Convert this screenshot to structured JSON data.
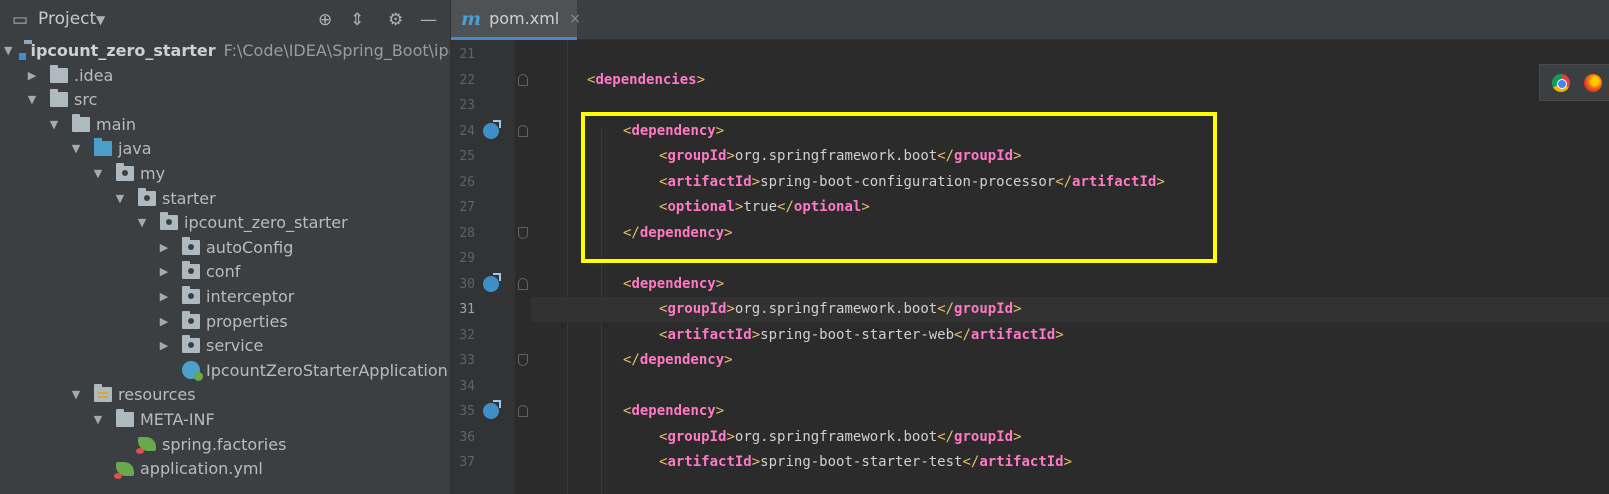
{
  "project_panel": {
    "title": "Project",
    "tree": [
      {
        "label": "ipcount_zero_starter",
        "path": "F:\\Code\\IDEA\\Spring_Boot\\ipcou",
        "icon": "module-icon",
        "expanded": true
      },
      {
        "label": ".idea",
        "icon": "folder-icon",
        "expanded": false
      },
      {
        "label": "src",
        "icon": "folder-icon",
        "expanded": true
      },
      {
        "label": "main",
        "icon": "folder-icon",
        "expanded": true
      },
      {
        "label": "java",
        "icon": "source-folder-icon",
        "expanded": true
      },
      {
        "label": "my",
        "icon": "package-icon",
        "expanded": true
      },
      {
        "label": "starter",
        "icon": "package-icon",
        "expanded": true
      },
      {
        "label": "ipcount_zero_starter",
        "icon": "package-icon",
        "expanded": true
      },
      {
        "label": "autoConfig",
        "icon": "package-icon",
        "expanded": false
      },
      {
        "label": "conf",
        "icon": "package-icon",
        "expanded": false
      },
      {
        "label": "interceptor",
        "icon": "package-icon",
        "expanded": false
      },
      {
        "label": "properties",
        "icon": "package-icon",
        "expanded": false
      },
      {
        "label": "service",
        "icon": "package-icon",
        "expanded": false
      },
      {
        "label": "IpcountZeroStarterApplication",
        "icon": "spring-boot-class-icon"
      },
      {
        "label": "resources",
        "icon": "resources-folder-icon",
        "expanded": true
      },
      {
        "label": "META-INF",
        "icon": "folder-icon",
        "expanded": true
      },
      {
        "label": "spring.factories",
        "icon": "spring-config-icon"
      },
      {
        "label": "application.yml",
        "icon": "spring-config-icon"
      }
    ]
  },
  "editor": {
    "tab": {
      "label": "pom.xml",
      "close_glyph": "×"
    },
    "current_line": 31,
    "lines": [
      {
        "n": "21",
        "parts": []
      },
      {
        "n": "22",
        "parts": [
          [
            "b",
            "<"
          ],
          [
            "t",
            "dependencies"
          ],
          [
            "b",
            ">"
          ]
        ]
      },
      {
        "n": "23",
        "parts": []
      },
      {
        "n": "24",
        "parts": [
          [
            "b",
            "<"
          ],
          [
            "t",
            "dependency"
          ],
          [
            "b",
            ">"
          ]
        ]
      },
      {
        "n": "25",
        "parts": [
          [
            "b",
            "<"
          ],
          [
            "t",
            "groupId"
          ],
          [
            "b",
            ">"
          ],
          [
            "x",
            "org.springframework.boot"
          ],
          [
            "b",
            "</"
          ],
          [
            "t",
            "groupId"
          ],
          [
            "b",
            ">"
          ]
        ]
      },
      {
        "n": "26",
        "parts": [
          [
            "b",
            "<"
          ],
          [
            "t",
            "artifactId"
          ],
          [
            "b",
            ">"
          ],
          [
            "x",
            "spring-boot-configuration-processor"
          ],
          [
            "b",
            "</"
          ],
          [
            "t",
            "artifactId"
          ],
          [
            "b",
            ">"
          ]
        ]
      },
      {
        "n": "27",
        "parts": [
          [
            "b",
            "<"
          ],
          [
            "t",
            "optional"
          ],
          [
            "b",
            ">"
          ],
          [
            "x",
            "true"
          ],
          [
            "b",
            "</"
          ],
          [
            "t",
            "optional"
          ],
          [
            "b",
            ">"
          ]
        ]
      },
      {
        "n": "28",
        "parts": [
          [
            "b",
            "</"
          ],
          [
            "t",
            "dependency"
          ],
          [
            "b",
            ">"
          ]
        ]
      },
      {
        "n": "29",
        "parts": []
      },
      {
        "n": "30",
        "parts": [
          [
            "b",
            "<"
          ],
          [
            "t",
            "dependency"
          ],
          [
            "b",
            ">"
          ]
        ]
      },
      {
        "n": "31",
        "parts": [
          [
            "b",
            "<"
          ],
          [
            "t",
            "groupId"
          ],
          [
            "b",
            ">"
          ],
          [
            "x",
            "org.springframework.boot"
          ],
          [
            "b",
            "</"
          ],
          [
            "t",
            "groupId"
          ],
          [
            "b",
            ">"
          ]
        ]
      },
      {
        "n": "32",
        "parts": [
          [
            "b",
            "<"
          ],
          [
            "t",
            "artifactId"
          ],
          [
            "b",
            ">"
          ],
          [
            "x",
            "spring-boot-starter-web"
          ],
          [
            "b",
            "</"
          ],
          [
            "t",
            "artifactId"
          ],
          [
            "b",
            ">"
          ]
        ]
      },
      {
        "n": "33",
        "parts": [
          [
            "b",
            "</"
          ],
          [
            "t",
            "dependency"
          ],
          [
            "b",
            ">"
          ]
        ]
      },
      {
        "n": "34",
        "parts": []
      },
      {
        "n": "35",
        "parts": [
          [
            "b",
            "<"
          ],
          [
            "t",
            "dependency"
          ],
          [
            "b",
            ">"
          ]
        ]
      },
      {
        "n": "36",
        "parts": [
          [
            "b",
            "<"
          ],
          [
            "t",
            "groupId"
          ],
          [
            "b",
            ">"
          ],
          [
            "x",
            "org.springframework.boot"
          ],
          [
            "b",
            "</"
          ],
          [
            "t",
            "groupId"
          ],
          [
            "b",
            ">"
          ]
        ]
      },
      {
        "n": "37",
        "parts": [
          [
            "b",
            "<"
          ],
          [
            "t",
            "artifactId"
          ],
          [
            "b",
            ">"
          ],
          [
            "x",
            "spring-boot-starter-test"
          ],
          [
            "b",
            "</"
          ],
          [
            "t",
            "artifactId"
          ],
          [
            "b",
            ">"
          ]
        ]
      }
    ],
    "run_markers": [
      "24",
      "30",
      "35"
    ]
  },
  "browser_popup": {
    "icons": [
      "chrome-icon",
      "firefox-icon"
    ]
  },
  "colors": {
    "accent": "#4a88c7",
    "tag_name": "#ff79c6",
    "bracket": "#e8bf6a",
    "highlight_box": "#ffff00"
  }
}
